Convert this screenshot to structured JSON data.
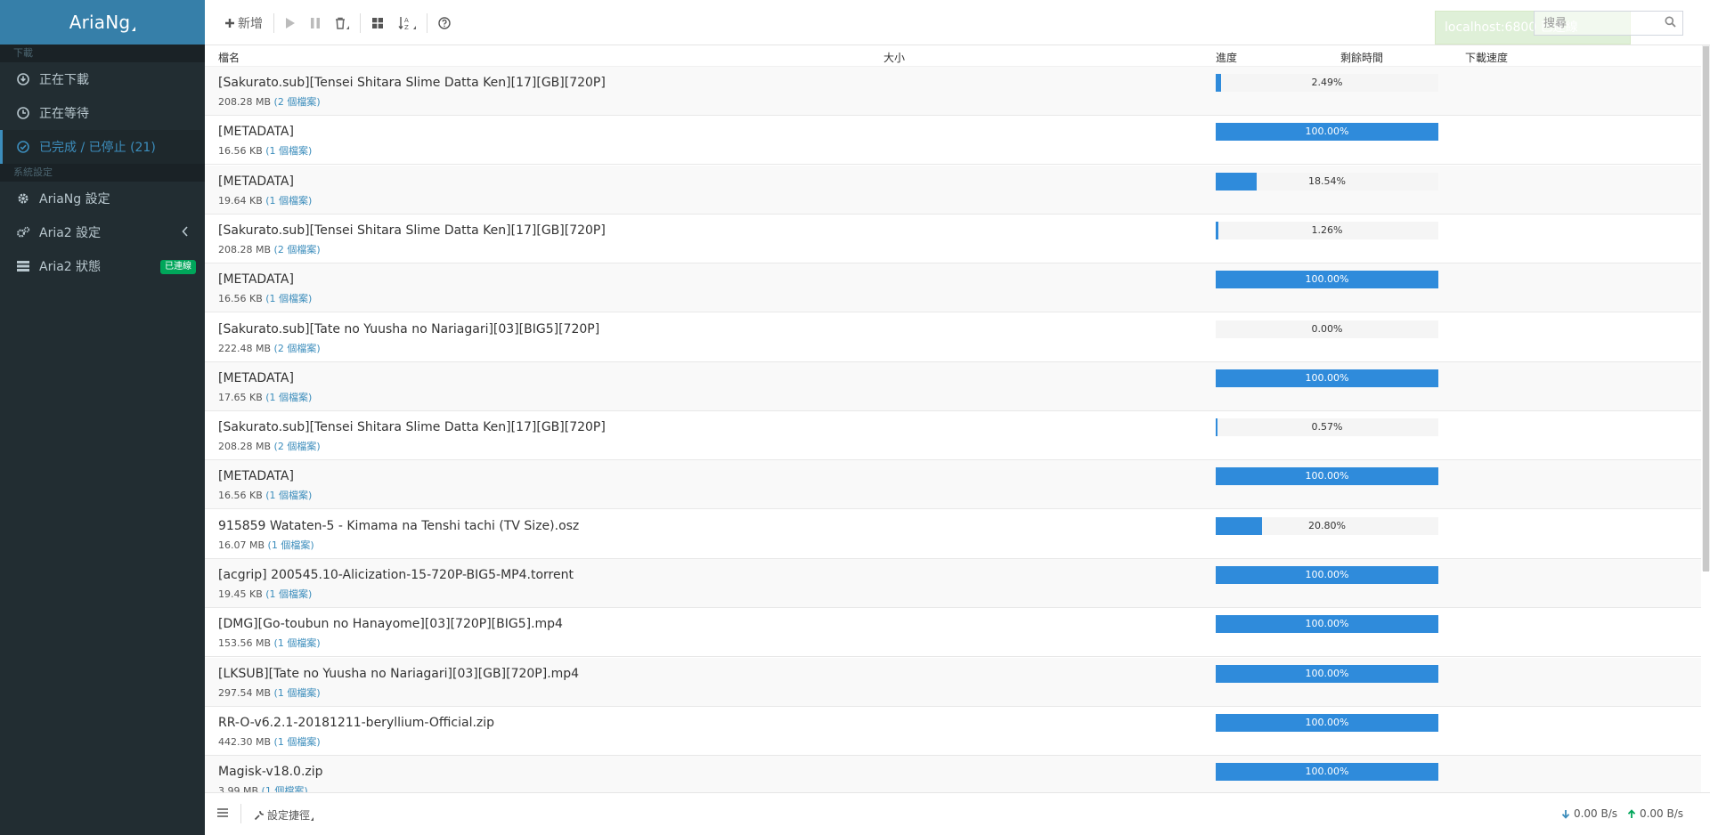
{
  "app": {
    "title": "AriaNg"
  },
  "sidebar": {
    "sections": {
      "downloads": "下載",
      "settings": "系統設定"
    },
    "items": [
      {
        "label": "正在下載",
        "icon": "arrow-circle-down-icon"
      },
      {
        "label": "正在等待",
        "icon": "clock-icon"
      },
      {
        "label": "已完成 / 已停止 (21)",
        "icon": "check-circle-icon",
        "active": true
      },
      {
        "label": "AriaNg 設定",
        "icon": "gear-icon"
      },
      {
        "label": "Aria2 設定",
        "icon": "gears-icon"
      },
      {
        "label": "Aria2 狀態",
        "icon": "server-icon",
        "badge": "已連線"
      }
    ]
  },
  "toolbar": {
    "add_label": "新增"
  },
  "status": {
    "text": "localhost:6800 已連線"
  },
  "search": {
    "placeholder": "搜尋"
  },
  "columns": {
    "name": "檔名",
    "size": "大小",
    "progress": "進度",
    "remaining": "剩餘時間",
    "speed": "下載速度"
  },
  "tasks": [
    {
      "name": "[Sakurato.sub][Tensei Shitara Slime Datta Ken][17][GB][720P]",
      "size": "208.28 MB",
      "files": "(2 個檔案)",
      "progress": "2.49%",
      "fraction": 0.0249
    },
    {
      "name": "[METADATA]",
      "size": "16.56 KB",
      "files": "(1 個檔案)",
      "progress": "100.00%",
      "fraction": 1.0
    },
    {
      "name": "[METADATA]",
      "size": "19.64 KB",
      "files": "(1 個檔案)",
      "progress": "18.54%",
      "fraction": 0.1854
    },
    {
      "name": "[Sakurato.sub][Tensei Shitara Slime Datta Ken][17][GB][720P]",
      "size": "208.28 MB",
      "files": "(2 個檔案)",
      "progress": "1.26%",
      "fraction": 0.0126
    },
    {
      "name": "[METADATA]",
      "size": "16.56 KB",
      "files": "(1 個檔案)",
      "progress": "100.00%",
      "fraction": 1.0
    },
    {
      "name": "[Sakurato.sub][Tate no Yuusha no Nariagari][03][BIG5][720P]",
      "size": "222.48 MB",
      "files": "(2 個檔案)",
      "progress": "0.00%",
      "fraction": 0.0
    },
    {
      "name": "[METADATA]",
      "size": "17.65 KB",
      "files": "(1 個檔案)",
      "progress": "100.00%",
      "fraction": 1.0
    },
    {
      "name": "[Sakurato.sub][Tensei Shitara Slime Datta Ken][17][GB][720P]",
      "size": "208.28 MB",
      "files": "(2 個檔案)",
      "progress": "0.57%",
      "fraction": 0.0057
    },
    {
      "name": "[METADATA]",
      "size": "16.56 KB",
      "files": "(1 個檔案)",
      "progress": "100.00%",
      "fraction": 1.0
    },
    {
      "name": "915859 Wataten-5 - Kimama na Tenshi tachi (TV Size).osz",
      "size": "16.07 MB",
      "files": "(1 個檔案)",
      "progress": "20.80%",
      "fraction": 0.208
    },
    {
      "name": "[acgrip] 200545.10-Alicization-15-720P-BIG5-MP4.torrent",
      "size": "19.45 KB",
      "files": "(1 個檔案)",
      "progress": "100.00%",
      "fraction": 1.0
    },
    {
      "name": "[DMG][Go-toubun no Hanayome][03][720P][BIG5].mp4",
      "size": "153.56 MB",
      "files": "(1 個檔案)",
      "progress": "100.00%",
      "fraction": 1.0
    },
    {
      "name": "[LKSUB][Tate no Yuusha no Nariagari][03][GB][720P].mp4",
      "size": "297.54 MB",
      "files": "(1 個檔案)",
      "progress": "100.00%",
      "fraction": 1.0
    },
    {
      "name": "RR-O-v6.2.1-20181211-beryllium-Official.zip",
      "size": "442.30 MB",
      "files": "(1 個檔案)",
      "progress": "100.00%",
      "fraction": 1.0
    },
    {
      "name": "Magisk-v18.0.zip",
      "size": "3.99 MB",
      "files": "(1 個檔案)",
      "progress": "100.00%",
      "fraction": 1.0
    }
  ],
  "footer": {
    "settings_label": "設定捷徑",
    "download_speed": "0.00 B/s",
    "upload_speed": "0.00 B/s"
  },
  "colors": {
    "sidebar_bg": "#222d32",
    "logo_bg": "#367fa9",
    "accent": "#3c8dbc",
    "progress": "#2f8bdb",
    "badge": "#00a65a"
  }
}
